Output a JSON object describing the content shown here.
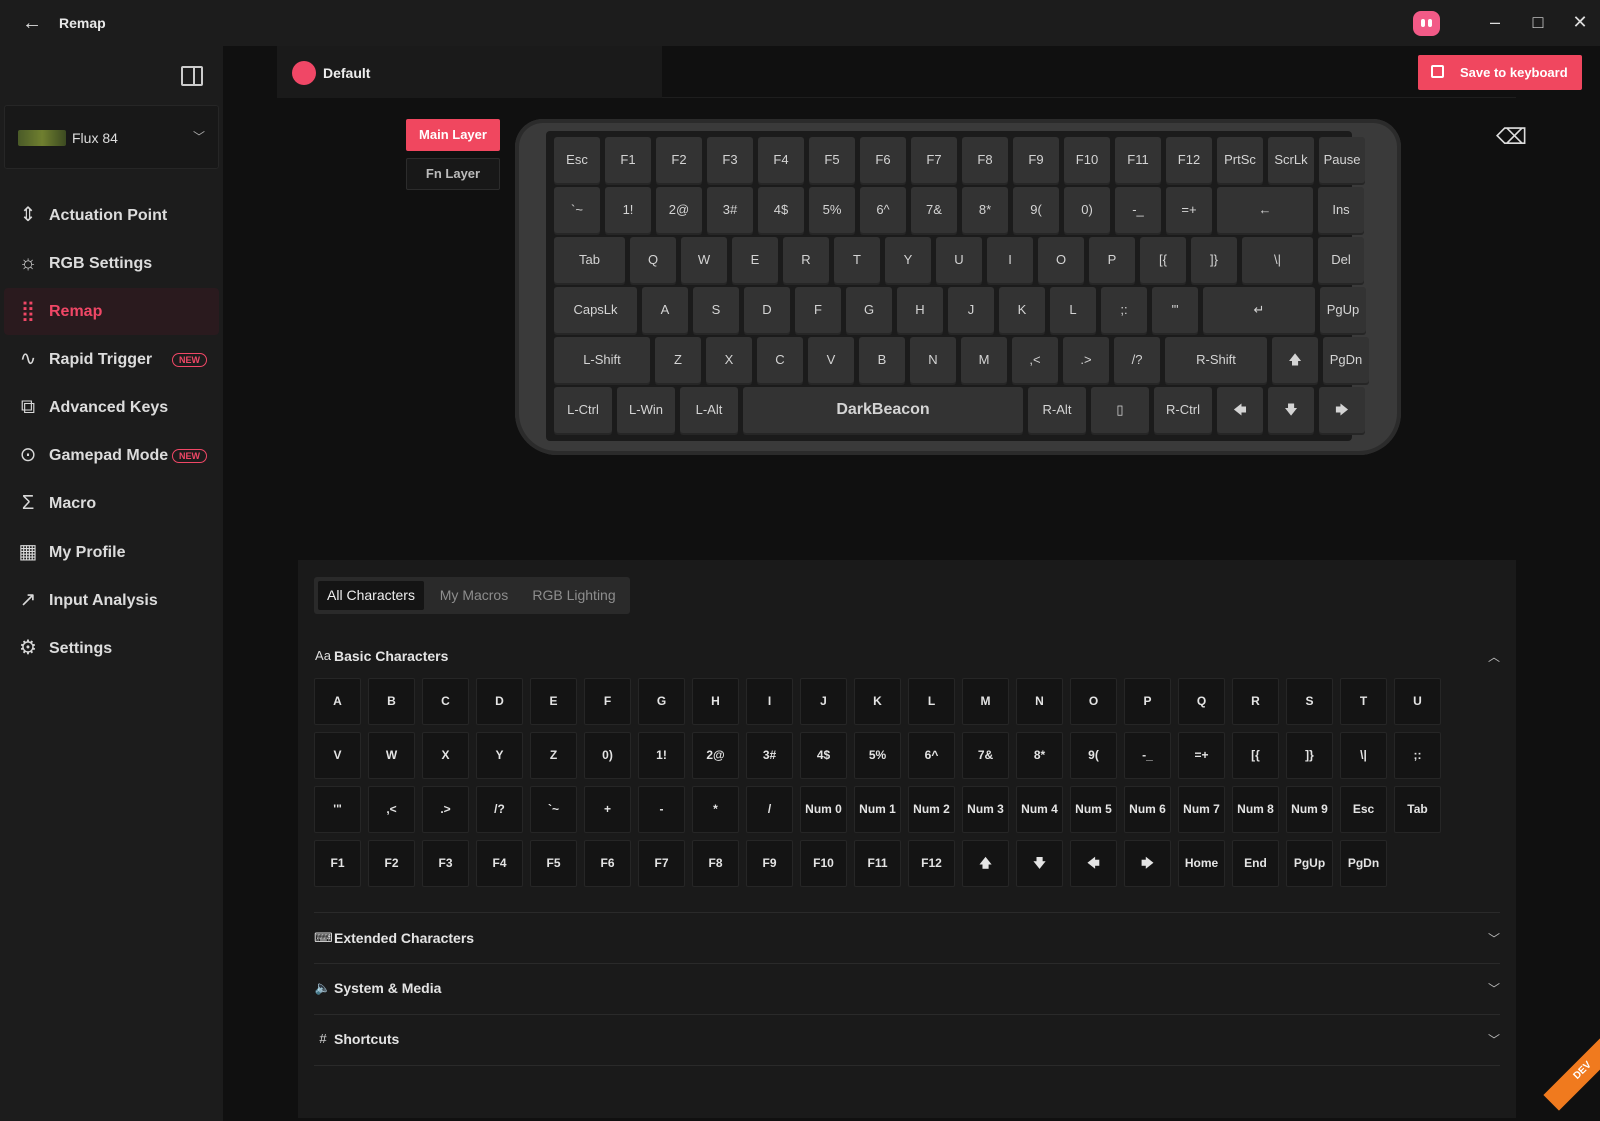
{
  "window": {
    "title": "Remap",
    "back_icon": "←",
    "minimize_icon": "–",
    "maximize_icon": "□",
    "close_icon": "✕"
  },
  "device": {
    "name": "Flux 84"
  },
  "nav": [
    {
      "label": "Actuation Point",
      "icon": "actuation-icon",
      "glyph": "⇕",
      "badge": ""
    },
    {
      "label": "RGB Settings",
      "icon": "sun-icon",
      "glyph": "☼",
      "badge": ""
    },
    {
      "label": "Remap",
      "icon": "remap-grid-icon",
      "glyph": "⣿",
      "badge": ""
    },
    {
      "label": "Rapid Trigger",
      "icon": "pulse-icon",
      "glyph": "∿",
      "badge": "NEW"
    },
    {
      "label": "Advanced Keys",
      "icon": "advanced-keys-icon",
      "glyph": "⧉",
      "badge": ""
    },
    {
      "label": "Gamepad Mode",
      "icon": "gamepad-icon",
      "glyph": "⊙",
      "badge": "NEW"
    },
    {
      "label": "Macro",
      "icon": "sigma-icon",
      "glyph": "Σ",
      "badge": ""
    },
    {
      "label": "My Profile",
      "icon": "profile-grid-icon",
      "glyph": "▦",
      "badge": ""
    },
    {
      "label": "Input Analysis",
      "icon": "chart-icon",
      "glyph": "↗",
      "badge": ""
    },
    {
      "label": "Settings",
      "icon": "gear-icon",
      "glyph": "⚙",
      "badge": ""
    }
  ],
  "active_nav": "Remap",
  "profile": {
    "name": "Default",
    "color": "#f04766"
  },
  "save_button": "Save to keyboard",
  "layers": {
    "main": "Main Layer",
    "fn": "Fn Layer"
  },
  "keyboard": {
    "rows": [
      [
        "Esc",
        "F1",
        "F2",
        "F3",
        "F4",
        "F5",
        "F6",
        "F7",
        "F8",
        "F9",
        "F10",
        "F11",
        "F12",
        "PrtSc",
        "ScrLk",
        "Pause"
      ],
      [
        "`~",
        "1!",
        "2@",
        "3#",
        "4$",
        "5%",
        "6^",
        "7&",
        "8*",
        "9(",
        "0)",
        "-_",
        "=+",
        "←",
        "Ins"
      ],
      [
        "Tab",
        "Q",
        "W",
        "E",
        "R",
        "T",
        "Y",
        "U",
        "I",
        "O",
        "P",
        "[{",
        "]}",
        "\\|",
        "Del"
      ],
      [
        "CapsLk",
        "A",
        "S",
        "D",
        "F",
        "G",
        "H",
        "J",
        "K",
        "L",
        ";:",
        "'\"",
        "↵",
        "PgUp"
      ],
      [
        "L-Shift",
        "Z",
        "X",
        "C",
        "V",
        "B",
        "N",
        "M",
        ",<",
        ".>",
        "/?",
        "R-Shift",
        "🡅",
        "PgDn"
      ],
      [
        "L-Ctrl",
        "L-Win",
        "L-Alt",
        "DarkBeacon",
        "R-Alt",
        "▯",
        "R-Ctrl",
        "🡄",
        "🡇",
        "🡆"
      ]
    ]
  },
  "char_tabs": [
    "All Characters",
    "My Macros",
    "RGB Lighting"
  ],
  "sections": {
    "basic": "Basic Characters",
    "extended": "Extended Characters",
    "system": "System & Media",
    "shortcuts": "Shortcuts"
  },
  "basic_chars": [
    [
      "A",
      "B",
      "C",
      "D",
      "E",
      "F",
      "G",
      "H",
      "I",
      "J",
      "K",
      "L",
      "M",
      "N",
      "O",
      "P",
      "Q",
      "R",
      "S",
      "T",
      "U"
    ],
    [
      "V",
      "W",
      "X",
      "Y",
      "Z",
      "0)",
      "1!",
      "2@",
      "3#",
      "4$",
      "5%",
      "6^",
      "7&",
      "8*",
      "9(",
      "-_",
      "=+",
      "[{",
      "]}",
      "\\|",
      ";:"
    ],
    [
      "'\"",
      ",<",
      ".>",
      "/?",
      "`~",
      "+",
      "-",
      "*",
      "/",
      "Num 0",
      "Num 1",
      "Num 2",
      "Num 3",
      "Num 4",
      "Num 5",
      "Num 6",
      "Num 7",
      "Num 8",
      "Num 9",
      "Esc",
      "Tab"
    ],
    [
      "F1",
      "F2",
      "F3",
      "F4",
      "F5",
      "F6",
      "F7",
      "F8",
      "F9",
      "F10",
      "F11",
      "F12",
      "🡅",
      "🡇",
      "🡄",
      "🡆",
      "Home",
      "End",
      "PgUp",
      "PgDn"
    ]
  ],
  "dev_ribbon": "DEV"
}
